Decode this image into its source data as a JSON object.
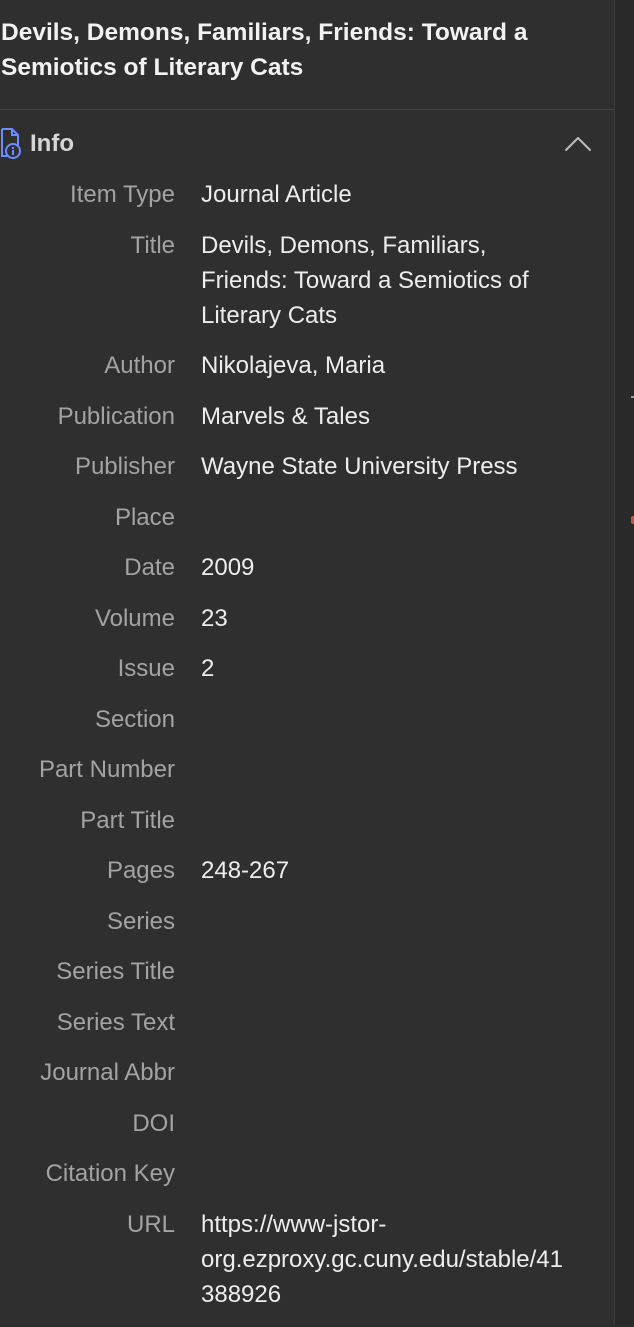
{
  "item": {
    "title": "Devils, Demons, Familiars, Friends: Toward a Semiotics of Literary Cats"
  },
  "info_section": {
    "label": "Info",
    "icon": "info-document-icon",
    "collapse_icon": "chevron-up-icon"
  },
  "fields": [
    {
      "key": "item-type",
      "label": "Item Type",
      "value": "Journal Article"
    },
    {
      "key": "title",
      "label": "Title",
      "value": "Devils, Demons, Familiars, Friends: Toward a Semiotics of Literary Cats"
    },
    {
      "key": "author",
      "label": "Author",
      "value": "Nikolajeva, Maria"
    },
    {
      "key": "publication",
      "label": "Publication",
      "value": "Marvels & Tales"
    },
    {
      "key": "publisher",
      "label": "Publisher",
      "value": "Wayne State University Press"
    },
    {
      "key": "place",
      "label": "Place",
      "value": ""
    },
    {
      "key": "date",
      "label": "Date",
      "value": "2009"
    },
    {
      "key": "volume",
      "label": "Volume",
      "value": "23"
    },
    {
      "key": "issue",
      "label": "Issue",
      "value": "2"
    },
    {
      "key": "section",
      "label": "Section",
      "value": ""
    },
    {
      "key": "part-number",
      "label": "Part Number",
      "value": ""
    },
    {
      "key": "part-title",
      "label": "Part Title",
      "value": ""
    },
    {
      "key": "pages",
      "label": "Pages",
      "value": "248-267"
    },
    {
      "key": "series",
      "label": "Series",
      "value": ""
    },
    {
      "key": "series-title",
      "label": "Series Title",
      "value": ""
    },
    {
      "key": "series-text",
      "label": "Series Text",
      "value": ""
    },
    {
      "key": "journal-abbr",
      "label": "Journal Abbr",
      "value": ""
    },
    {
      "key": "doi",
      "label": "DOI",
      "value": ""
    },
    {
      "key": "citation-key",
      "label": "Citation Key",
      "value": ""
    },
    {
      "key": "url",
      "label": "URL",
      "value": "https://www-jstor-org.ezproxy.gc.cuny.edu/stable/41388926"
    }
  ],
  "colors": {
    "background": "#2f2f2f",
    "label": "#a3a3a3",
    "value": "#ededed",
    "icon_accent": "#6b8cff"
  }
}
